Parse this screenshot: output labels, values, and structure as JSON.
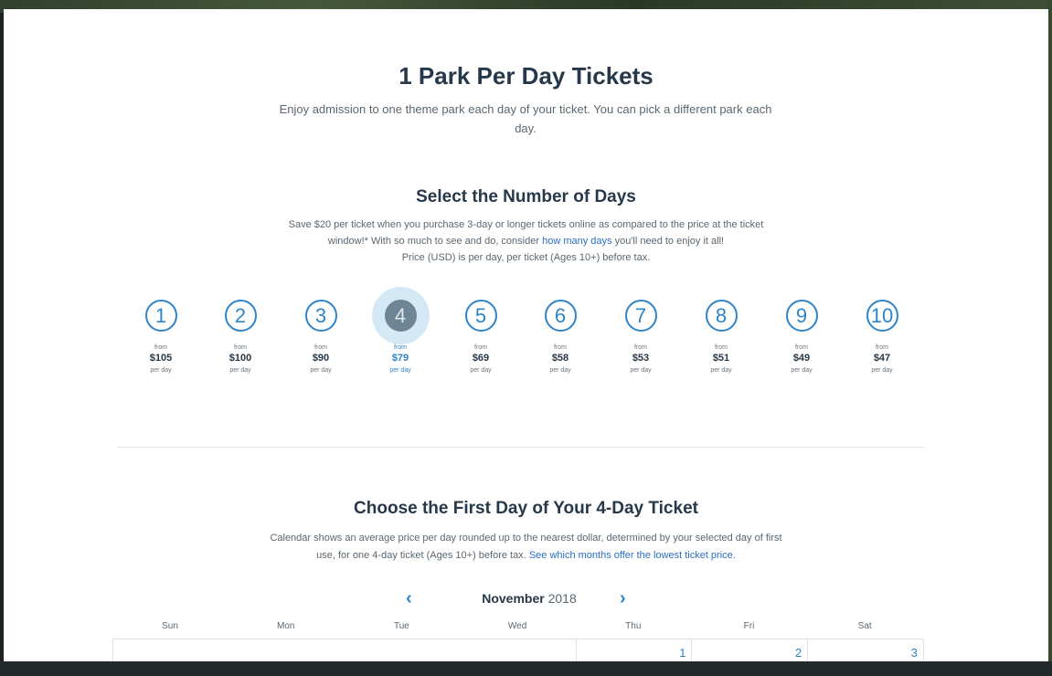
{
  "title": "1 Park Per Day Tickets",
  "intro": "Enjoy admission to one theme park each day of your ticket. You can pick a different park each day.",
  "days_section": {
    "heading": "Select the Number of Days",
    "save_before": "Save $20 per ticket when you purchase 3-day or longer tickets online as compared to the price at the ticket window!* With so much to see and do, consider ",
    "save_link": "how many days",
    "save_after": " you'll need to enjoy it all!",
    "price_note": "Price (USD) is per day, per ticket (Ages 10+) before tax.",
    "from_label": "from",
    "per_day_label": "per day",
    "selected_day": 4,
    "options": [
      {
        "days": "1",
        "price": "$105"
      },
      {
        "days": "2",
        "price": "$100"
      },
      {
        "days": "3",
        "price": "$90"
      },
      {
        "days": "4",
        "price": "$79"
      },
      {
        "days": "5",
        "price": "$69"
      },
      {
        "days": "6",
        "price": "$58"
      },
      {
        "days": "7",
        "price": "$53"
      },
      {
        "days": "8",
        "price": "$51"
      },
      {
        "days": "9",
        "price": "$49"
      },
      {
        "days": "10",
        "price": "$47"
      }
    ]
  },
  "calendar_section": {
    "heading": "Choose the First Day of Your 4-Day Ticket",
    "desc": "Calendar shows an average price per day rounded up to the nearest dollar, determined by your selected day of first use, for one 4-day ticket (Ages 10+) before tax. ",
    "desc_link": "See which months offer the lowest ticket price.",
    "prev_icon": "chevron-left-icon",
    "next_icon": "chevron-right-icon",
    "prev_glyph": "‹",
    "next_glyph": "›",
    "month": "November",
    "year": "2018",
    "weekdays": [
      "Sun",
      "Mon",
      "Tue",
      "Wed",
      "Thu",
      "Fri",
      "Sat"
    ],
    "first_row": [
      "",
      "",
      "",
      "",
      "1",
      "2",
      "3"
    ]
  },
  "colors": {
    "accent": "#2e84c9",
    "heading": "#263849",
    "text": "#5b6770"
  }
}
